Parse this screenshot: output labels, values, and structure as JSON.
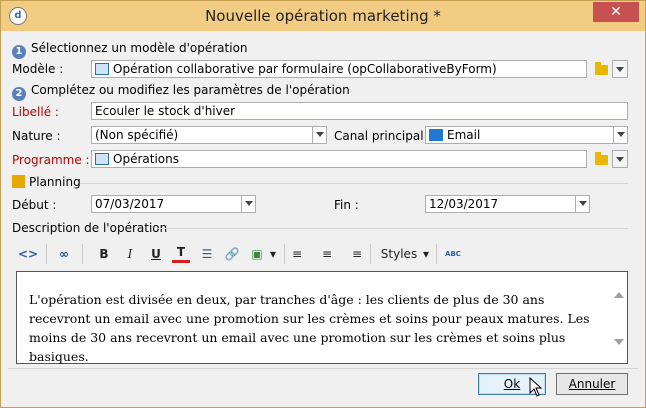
{
  "window": {
    "title": "Nouvelle opération marketing *",
    "close_glyph": "✕",
    "app_icon": "d"
  },
  "step1": {
    "number": "1",
    "label": "Sélectionnez un modèle d'opération"
  },
  "modele": {
    "label": "Modèle :",
    "value": "Opération collaborative par formulaire (opCollaborativeByForm)"
  },
  "step2": {
    "number": "2",
    "label": "Complétez ou modifiez les paramètres de l'opération"
  },
  "libelle": {
    "label": "Libellé :",
    "value": "Ecouler le stock d'hiver"
  },
  "nature": {
    "label": "Nature :",
    "value": "(Non spécifié)"
  },
  "canal": {
    "label": "Canal principal :",
    "value": "Email"
  },
  "programme": {
    "label": "Programme :",
    "value": "Opérations"
  },
  "planning": {
    "label": "Planning"
  },
  "debut": {
    "label": "Début :",
    "value": "07/03/2017"
  },
  "fin": {
    "label": "Fin :",
    "value": "12/03/2017"
  },
  "description": {
    "label": "Description de l'opération",
    "text": "L'opération est divisée en deux, par tranches d'âge : les clients de plus de 30 ans recevront un email avec une promotion sur les crèmes et soins pour peaux matures. Les moins de 30 ans recevront un email avec une promotion sur les crèmes et soins plus basiques."
  },
  "toolbar": {
    "source_glyph": "<>",
    "find_glyph": "∞",
    "bold": "B",
    "italic": "I",
    "underline": "U",
    "textcolor": "T",
    "list_glyph": "☰",
    "link_glyph": "🔗",
    "image_glyph": "▣",
    "align_left": "≡",
    "align_center": "≡",
    "align_right": "≡",
    "styles": "Styles",
    "spell": "ABC"
  },
  "buttons": {
    "ok": "Ok",
    "cancel": "Annuler"
  },
  "colors": {
    "titlebar": "#f2cc82",
    "required_label": "#c00000",
    "close": "#c75050"
  }
}
